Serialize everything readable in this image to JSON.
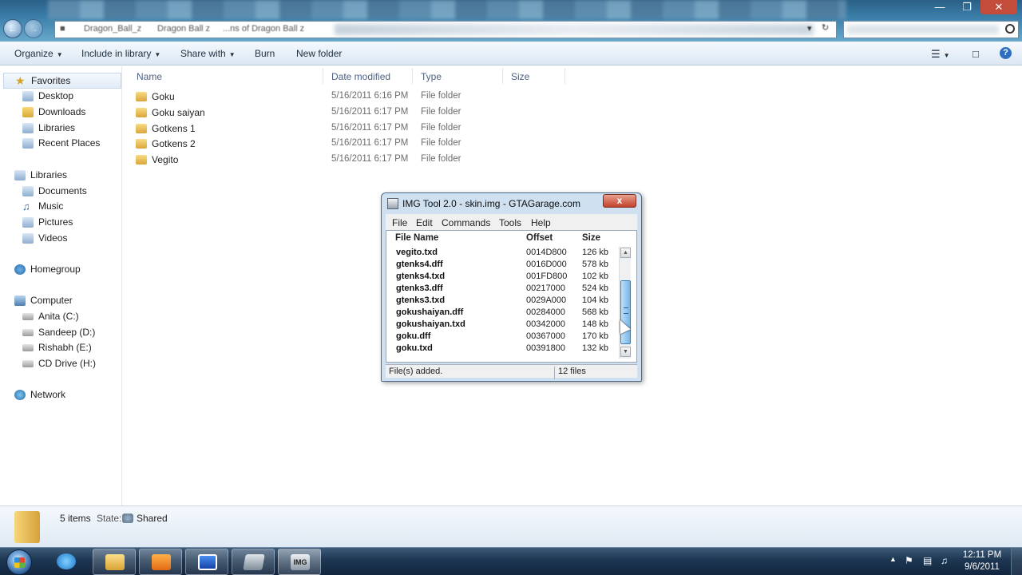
{
  "window": {
    "controls": {
      "minimize": "—",
      "maximize": "❐",
      "close": "✕"
    },
    "nav": {
      "back": "←",
      "forward": "→"
    },
    "breadcrumb": [
      "Dragon_Ball_z",
      "Dragon Ball z",
      "...ns of Dragon Ball z"
    ],
    "refresh_icon": "refresh-icon"
  },
  "toolbar": {
    "organize": "Organize",
    "include": "Include in library",
    "share": "Share with",
    "burn": "Burn",
    "new_folder": "New folder"
  },
  "navpane": {
    "favorites": "Favorites",
    "fav_items": [
      "Desktop",
      "Downloads",
      "Libraries",
      "Recent Places"
    ],
    "libraries": "Libraries",
    "lib_items": [
      "Documents",
      "Music",
      "Pictures",
      "Videos"
    ],
    "homegroup": "Homegroup",
    "computer": "Computer",
    "comp_items": [
      "Anita (C:)",
      "Sandeep (D:)",
      "Rishabh (E:)",
      "CD Drive (H:)"
    ],
    "network": "Network"
  },
  "columns": {
    "name": "Name",
    "date": "Date modified",
    "type": "Type",
    "size": "Size"
  },
  "files": [
    {
      "name": "Goku",
      "date": "5/16/2011 6:16 PM",
      "type": "File folder"
    },
    {
      "name": "Goku saiyan",
      "date": "5/16/2011 6:17 PM",
      "type": "File folder"
    },
    {
      "name": "Gotkens 1",
      "date": "5/16/2011 6:17 PM",
      "type": "File folder"
    },
    {
      "name": "Gotkens 2",
      "date": "5/16/2011 6:17 PM",
      "type": "File folder"
    },
    {
      "name": "Vegito",
      "date": "5/16/2011 6:17 PM",
      "type": "File folder"
    }
  ],
  "dialog": {
    "title": "IMG Tool 2.0 - skin.img - GTAGarage.com",
    "close": "x",
    "menu": [
      "File",
      "Edit",
      "Commands",
      "Tools",
      "Help"
    ],
    "headers": {
      "name": "File Name",
      "offset": "Offset",
      "size": "Size"
    },
    "entries": [
      {
        "name": "vegito.txd",
        "offset": "0014D800",
        "size": "126 kb"
      },
      {
        "name": "gtenks4.dff",
        "offset": "0016D000",
        "size": "578 kb"
      },
      {
        "name": "gtenks4.txd",
        "offset": "001FD800",
        "size": "102 kb"
      },
      {
        "name": "gtenks3.dff",
        "offset": "00217000",
        "size": "524 kb"
      },
      {
        "name": "gtenks3.txd",
        "offset": "0029A000",
        "size": "104 kb"
      },
      {
        "name": "gokushaiyan.dff",
        "offset": "00284000",
        "size": "568 kb"
      },
      {
        "name": "gokushaiyan.txd",
        "offset": "00342000",
        "size": "148 kb"
      },
      {
        "name": "goku.dff",
        "offset": "00367000",
        "size": "170 kb"
      },
      {
        "name": "goku.txd",
        "offset": "00391800",
        "size": "132 kb"
      }
    ],
    "status_left": "File(s) added.",
    "status_right": "12 files"
  },
  "details": {
    "count": "5 items",
    "state_label": "State:",
    "state_value": "Shared"
  },
  "taskbar": {
    "time": "12:11 PM",
    "date": "9/6/2011",
    "apps": [
      "internet-explorer",
      "windows-explorer",
      "media-player",
      "app-blue",
      "app-grey",
      "img-tool"
    ],
    "img_label": "IMG"
  },
  "colors": {
    "accent": "#3a7ea8",
    "taskbar": "#1d3651",
    "dialog_frame": "#cfe0f1",
    "close_red": "#c3422c"
  }
}
